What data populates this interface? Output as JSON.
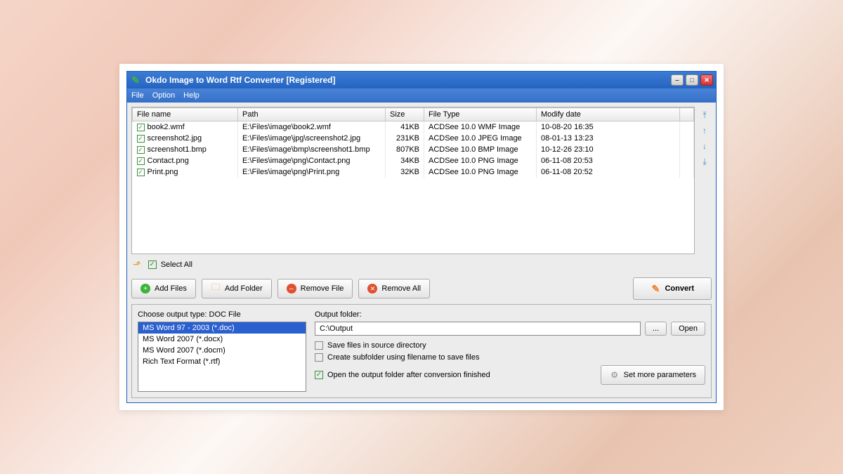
{
  "titlebar": {
    "title": "Okdo Image to Word Rtf Converter [Registered]"
  },
  "menu": {
    "file": "File",
    "option": "Option",
    "help": "Help"
  },
  "columns": {
    "filename": "File name",
    "path": "Path",
    "size": "Size",
    "filetype": "File Type",
    "modify": "Modify date"
  },
  "files": [
    {
      "name": "book2.wmf",
      "path": "E:\\Files\\image\\book2.wmf",
      "size": "41KB",
      "type": "ACDSee 10.0 WMF Image",
      "modify": "10-08-20 16:35"
    },
    {
      "name": "screenshot2.jpg",
      "path": "E:\\Files\\image\\jpg\\screenshot2.jpg",
      "size": "231KB",
      "type": "ACDSee 10.0 JPEG Image",
      "modify": "08-01-13 13:23"
    },
    {
      "name": "screenshot1.bmp",
      "path": "E:\\Files\\image\\bmp\\screenshot1.bmp",
      "size": "807KB",
      "type": "ACDSee 10.0 BMP Image",
      "modify": "10-12-26 23:10"
    },
    {
      "name": "Contact.png",
      "path": "E:\\Files\\image\\png\\Contact.png",
      "size": "34KB",
      "type": "ACDSee 10.0 PNG Image",
      "modify": "06-11-08 20:53"
    },
    {
      "name": "Print.png",
      "path": "E:\\Files\\image\\png\\Print.png",
      "size": "32KB",
      "type": "ACDSee 10.0 PNG Image",
      "modify": "06-11-08 20:52"
    }
  ],
  "select_all": "Select All",
  "buttons": {
    "add_files": "Add Files",
    "add_folder": "Add Folder",
    "remove_file": "Remove File",
    "remove_all": "Remove All",
    "convert": "Convert",
    "browse": "...",
    "open": "Open",
    "set_params": "Set more parameters"
  },
  "output": {
    "choose_type_label": "Choose output type:  DOC File",
    "types": [
      "MS Word 97 - 2003 (*.doc)",
      "MS Word 2007 (*.docx)",
      "MS Word 2007 (*.docm)",
      "Rich Text Format (*.rtf)"
    ],
    "selected_type_index": 0,
    "folder_label": "Output folder:",
    "folder_value": "C:\\Output",
    "opt_save_source": "Save files in source directory",
    "opt_subfolder": "Create subfolder using filename to save files",
    "opt_open_after": "Open the output folder after conversion finished"
  }
}
